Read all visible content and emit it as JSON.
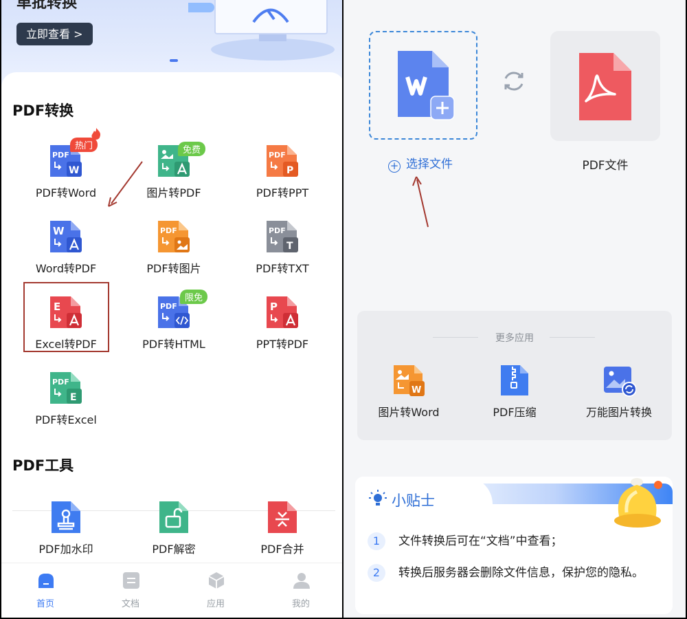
{
  "banner": {
    "title": "单批转换",
    "view_button": "立即查看 >"
  },
  "conversion": {
    "title": "PDF转换",
    "tools": [
      {
        "label": "PDF转Word",
        "icon": "pdf-to-word-icon",
        "badge": "热门"
      },
      {
        "label": "图片转PDF",
        "icon": "image-to-pdf-icon",
        "badge": "免费"
      },
      {
        "label": "PDF转PPT",
        "icon": "pdf-to-ppt-icon"
      },
      {
        "label": "Word转PDF",
        "icon": "word-to-pdf-icon"
      },
      {
        "label": "PDF转图片",
        "icon": "pdf-to-image-icon"
      },
      {
        "label": "PDF转TXT",
        "icon": "pdf-to-txt-icon"
      },
      {
        "label": "Excel转PDF",
        "icon": "excel-to-pdf-icon"
      },
      {
        "label": "PDF转HTML",
        "icon": "pdf-to-html-icon",
        "badge": "限免"
      },
      {
        "label": "PPT转PDF",
        "icon": "ppt-to-pdf-icon"
      },
      {
        "label": "PDF转Excel",
        "icon": "pdf-to-excel-icon"
      }
    ]
  },
  "pdf_tools": {
    "title": "PDF工具",
    "tools": [
      {
        "label": "PDF加水印",
        "icon": "watermark-icon"
      },
      {
        "label": "PDF解密",
        "icon": "unlock-icon"
      },
      {
        "label": "PDF合并",
        "icon": "merge-icon"
      }
    ]
  },
  "bottom_nav": [
    {
      "label": "首页",
      "icon": "home-icon",
      "active": true
    },
    {
      "label": "文档",
      "icon": "document-icon"
    },
    {
      "label": "应用",
      "icon": "apps-icon"
    },
    {
      "label": "我的",
      "icon": "profile-icon"
    }
  ],
  "converter": {
    "select_file": "选择文件",
    "target_label": "PDF文件"
  },
  "more_apps": {
    "title": "更多应用",
    "apps": [
      {
        "label": "图片转Word",
        "icon": "image-to-word-icon"
      },
      {
        "label": "PDF压缩",
        "icon": "compress-icon"
      },
      {
        "label": "万能图片转换",
        "icon": "image-convert-icon"
      }
    ]
  },
  "tips": {
    "title": "小贴士",
    "items": [
      {
        "num": "1",
        "text": "文件转换后可在“文档”中查看；"
      },
      {
        "num": "2",
        "text": "转换后服务器会删除文件信息，保护您的隐私。"
      }
    ]
  },
  "colors": {
    "accent": "#3d7bf3",
    "pdf_red": "#e8484f",
    "word_blue": "#4a72e8",
    "annotation_red": "#a3382f"
  }
}
